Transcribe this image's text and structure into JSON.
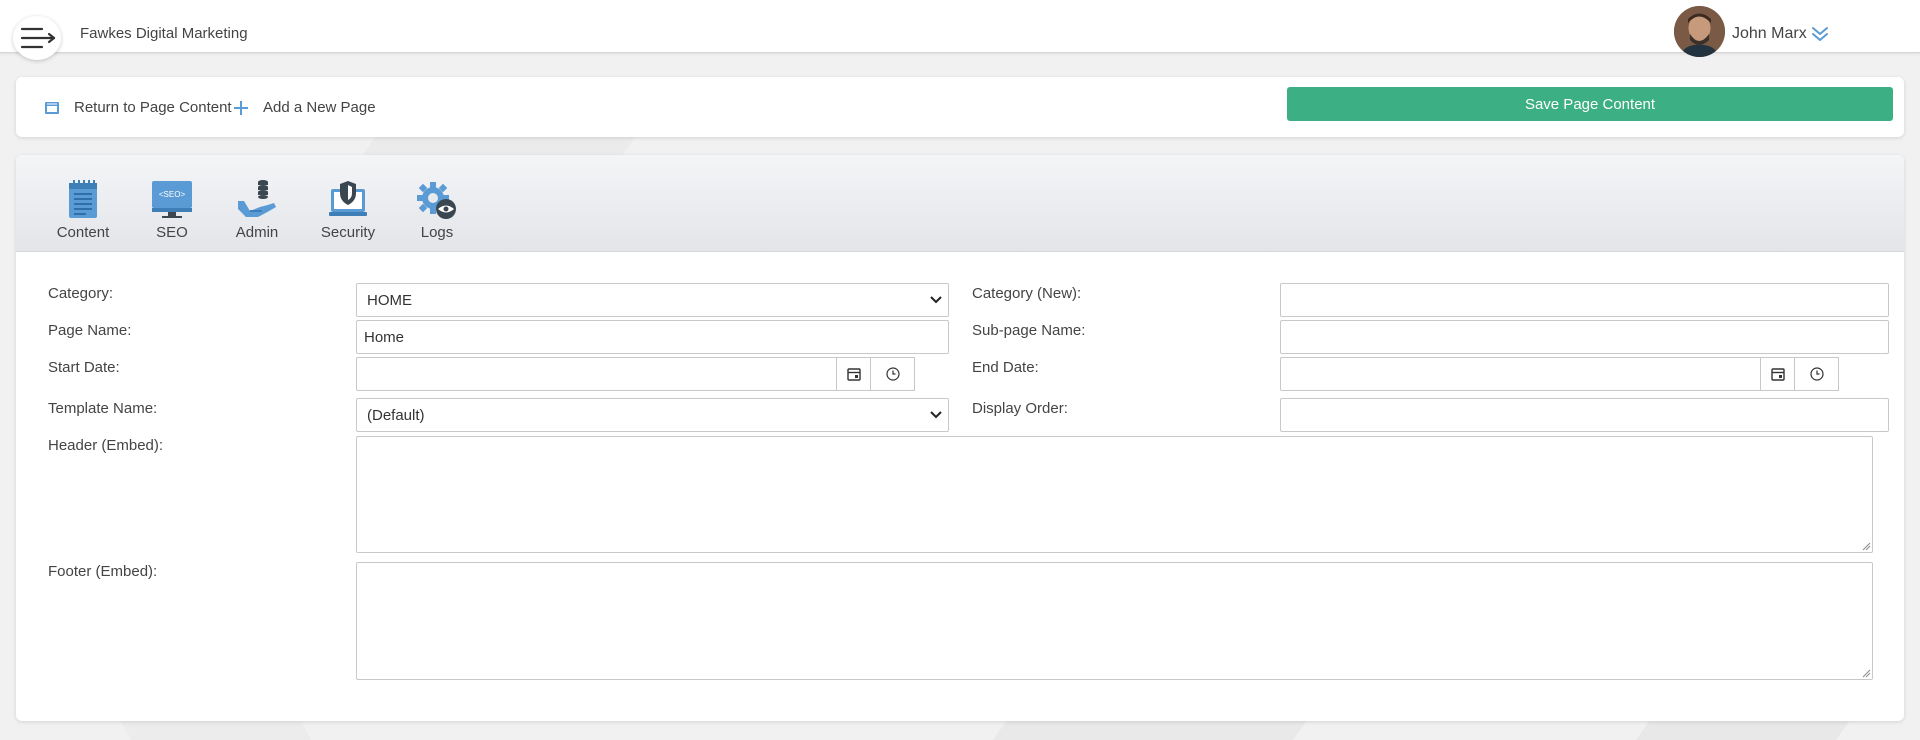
{
  "header": {
    "brand": "Fawkes Digital Marketing",
    "user_name": "John Marx"
  },
  "actions": {
    "return_label": "Return to Page Content",
    "add_label": "Add a New Page",
    "save_label": "Save Page Content"
  },
  "tabs": [
    {
      "label": "Content",
      "icon": "content-icon"
    },
    {
      "label": "SEO",
      "icon": "seo-icon",
      "badge": "<SEO>"
    },
    {
      "label": "Admin",
      "icon": "admin-icon"
    },
    {
      "label": "Security",
      "icon": "security-icon"
    },
    {
      "label": "Logs",
      "icon": "logs-icon"
    }
  ],
  "form": {
    "category": {
      "label": "Category:",
      "value": "HOME"
    },
    "category_new": {
      "label": "Category (New):",
      "value": ""
    },
    "page_name": {
      "label": "Page Name:",
      "value": "Home"
    },
    "subpage_name": {
      "label": "Sub-page Name:",
      "value": ""
    },
    "start_date": {
      "label": "Start Date:",
      "value": ""
    },
    "end_date": {
      "label": "End Date:",
      "value": ""
    },
    "template_name": {
      "label": "Template Name:",
      "value": "(Default)"
    },
    "display_order": {
      "label": "Display Order:",
      "value": ""
    },
    "header_embed": {
      "label": "Header (Embed):",
      "value": ""
    },
    "footer_embed": {
      "label": "Footer (Embed):",
      "value": ""
    }
  },
  "colors": {
    "accent": "#3daf84",
    "icon_blue": "#5b9bd5"
  }
}
